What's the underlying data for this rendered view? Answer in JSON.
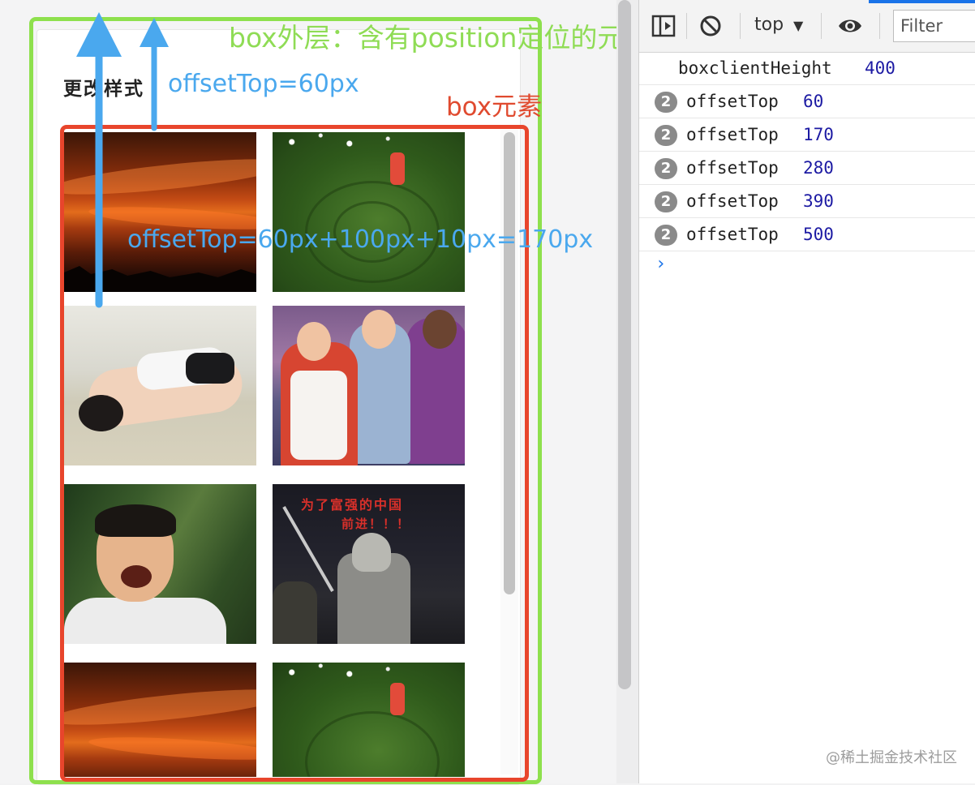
{
  "left_page": {
    "card_title": "更改样式",
    "annotations": {
      "green_label": "box外层：含有position定位的元素",
      "offset_top_60": "offsetTop=60px",
      "box_label": "box元素",
      "offset_top_170": "offsetTop=60px+100px+10px=170px"
    },
    "colors": {
      "green": "#8ee04d",
      "red": "#e8452c",
      "blue": "#4aa8ee"
    },
    "images": [
      {
        "name": "sunset",
        "soldier_text_1": "",
        "soldier_text_2": ""
      },
      {
        "name": "grass"
      },
      {
        "name": "bed"
      },
      {
        "name": "kids"
      },
      {
        "name": "scream"
      },
      {
        "name": "soldier",
        "caption_1": "为了富强的中国",
        "caption_2": "前进！！！"
      },
      {
        "name": "sunset"
      },
      {
        "name": "grass"
      }
    ]
  },
  "devtools": {
    "context": "top",
    "context_caret": "▼",
    "filter_placeholder": "Filter",
    "logs": [
      {
        "label": "boxclientHeight",
        "value": "400",
        "count": ""
      },
      {
        "label": "offsetTop",
        "value": "60",
        "count": "2"
      },
      {
        "label": "offsetTop",
        "value": "170",
        "count": "2"
      },
      {
        "label": "offsetTop",
        "value": "280",
        "count": "2"
      },
      {
        "label": "offsetTop",
        "value": "390",
        "count": "2"
      },
      {
        "label": "offsetTop",
        "value": "500",
        "count": "2"
      }
    ],
    "prompt": "›",
    "accent": "#1a73e8"
  },
  "watermark": "@稀土掘金技术社区"
}
